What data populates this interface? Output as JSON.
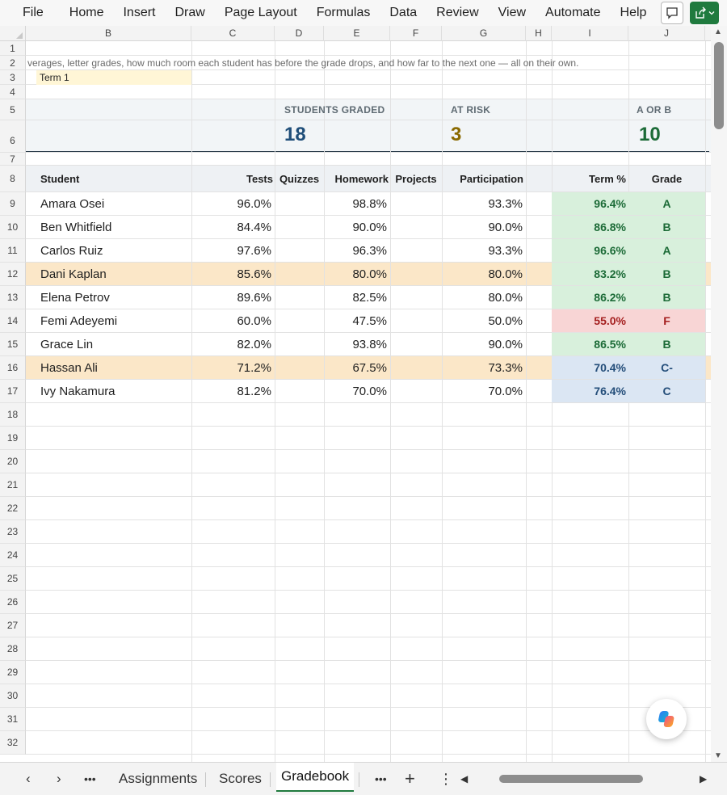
{
  "menu": [
    "File",
    "Home",
    "Insert",
    "Draw",
    "Page Layout",
    "Formulas",
    "Data",
    "Review",
    "View",
    "Automate",
    "Help"
  ],
  "columns": [
    "B",
    "C",
    "D",
    "E",
    "F",
    "G",
    "H",
    "I",
    "J"
  ],
  "rows": [
    "1",
    "2",
    "3",
    "4",
    "5",
    "6",
    "7",
    "8",
    "9",
    "10",
    "11",
    "12",
    "13",
    "14",
    "15",
    "16",
    "17",
    "18",
    "19",
    "20",
    "21",
    "22",
    "23",
    "24",
    "25",
    "26",
    "27",
    "28",
    "29",
    "30",
    "31",
    "32"
  ],
  "intro_text": "verages, letter grades, how much room each student has before the grade drops, and how far to the next one — all on their own.",
  "term_label": "Term 1",
  "kpis": [
    {
      "label": "STUDENTS GRADED",
      "value": "18",
      "color": "#1f4e79"
    },
    {
      "label": "AT RISK",
      "value": "3",
      "color": "#8a6a00"
    },
    {
      "label": "A OR B",
      "value": "10",
      "color": "#1c6b37"
    }
  ],
  "table": {
    "headers": {
      "student": "Student",
      "tests": "Tests",
      "quizzes": "Quizzes",
      "homework": "Homework",
      "projects": "Projects",
      "participation": "Participation",
      "term": "Term %",
      "grade": "Grade"
    },
    "rows": [
      {
        "student": "Amara Osei",
        "tests": "96.0%",
        "homework": "98.8%",
        "participation": "93.3%",
        "term": "96.4%",
        "grade": "A",
        "band": "green",
        "highlight": false
      },
      {
        "student": "Ben Whitfield",
        "tests": "84.4%",
        "homework": "90.0%",
        "participation": "90.0%",
        "term": "86.8%",
        "grade": "B",
        "band": "green",
        "highlight": false
      },
      {
        "student": "Carlos Ruiz",
        "tests": "97.6%",
        "homework": "96.3%",
        "participation": "93.3%",
        "term": "96.6%",
        "grade": "A",
        "band": "green",
        "highlight": false
      },
      {
        "student": "Dani Kaplan",
        "tests": "85.6%",
        "homework": "80.0%",
        "participation": "80.0%",
        "term": "83.2%",
        "grade": "B",
        "band": "green",
        "highlight": true
      },
      {
        "student": "Elena Petrov",
        "tests": "89.6%",
        "homework": "82.5%",
        "participation": "80.0%",
        "term": "86.2%",
        "grade": "B",
        "band": "green",
        "highlight": false
      },
      {
        "student": "Femi Adeyemi",
        "tests": "60.0%",
        "homework": "47.5%",
        "participation": "50.0%",
        "term": "55.0%",
        "grade": "F",
        "band": "red",
        "highlight": false
      },
      {
        "student": "Grace Lin",
        "tests": "82.0%",
        "homework": "93.8%",
        "participation": "90.0%",
        "term": "86.5%",
        "grade": "B",
        "band": "green",
        "highlight": false
      },
      {
        "student": "Hassan Ali",
        "tests": "71.2%",
        "homework": "67.5%",
        "participation": "73.3%",
        "term": "70.4%",
        "grade": "C-",
        "band": "blue",
        "highlight": true
      },
      {
        "student": "Ivy Nakamura",
        "tests": "81.2%",
        "homework": "70.0%",
        "participation": "70.0%",
        "term": "76.4%",
        "grade": "C",
        "band": "blue",
        "highlight": false
      }
    ]
  },
  "sheet_tabs": [
    "Assignments",
    "Scores",
    "Gradebook"
  ],
  "active_tab": "Gradebook",
  "tab_more": "•••",
  "tab_add": "+",
  "tab_options": "⋮",
  "colors": {
    "accent_green": "#1f7a3e",
    "highlight_row": "#fbe7c8",
    "grade_green_bg": "#d8f0dc",
    "grade_red_bg": "#f8d5d5",
    "grade_blue_bg": "#dbe6f3"
  }
}
